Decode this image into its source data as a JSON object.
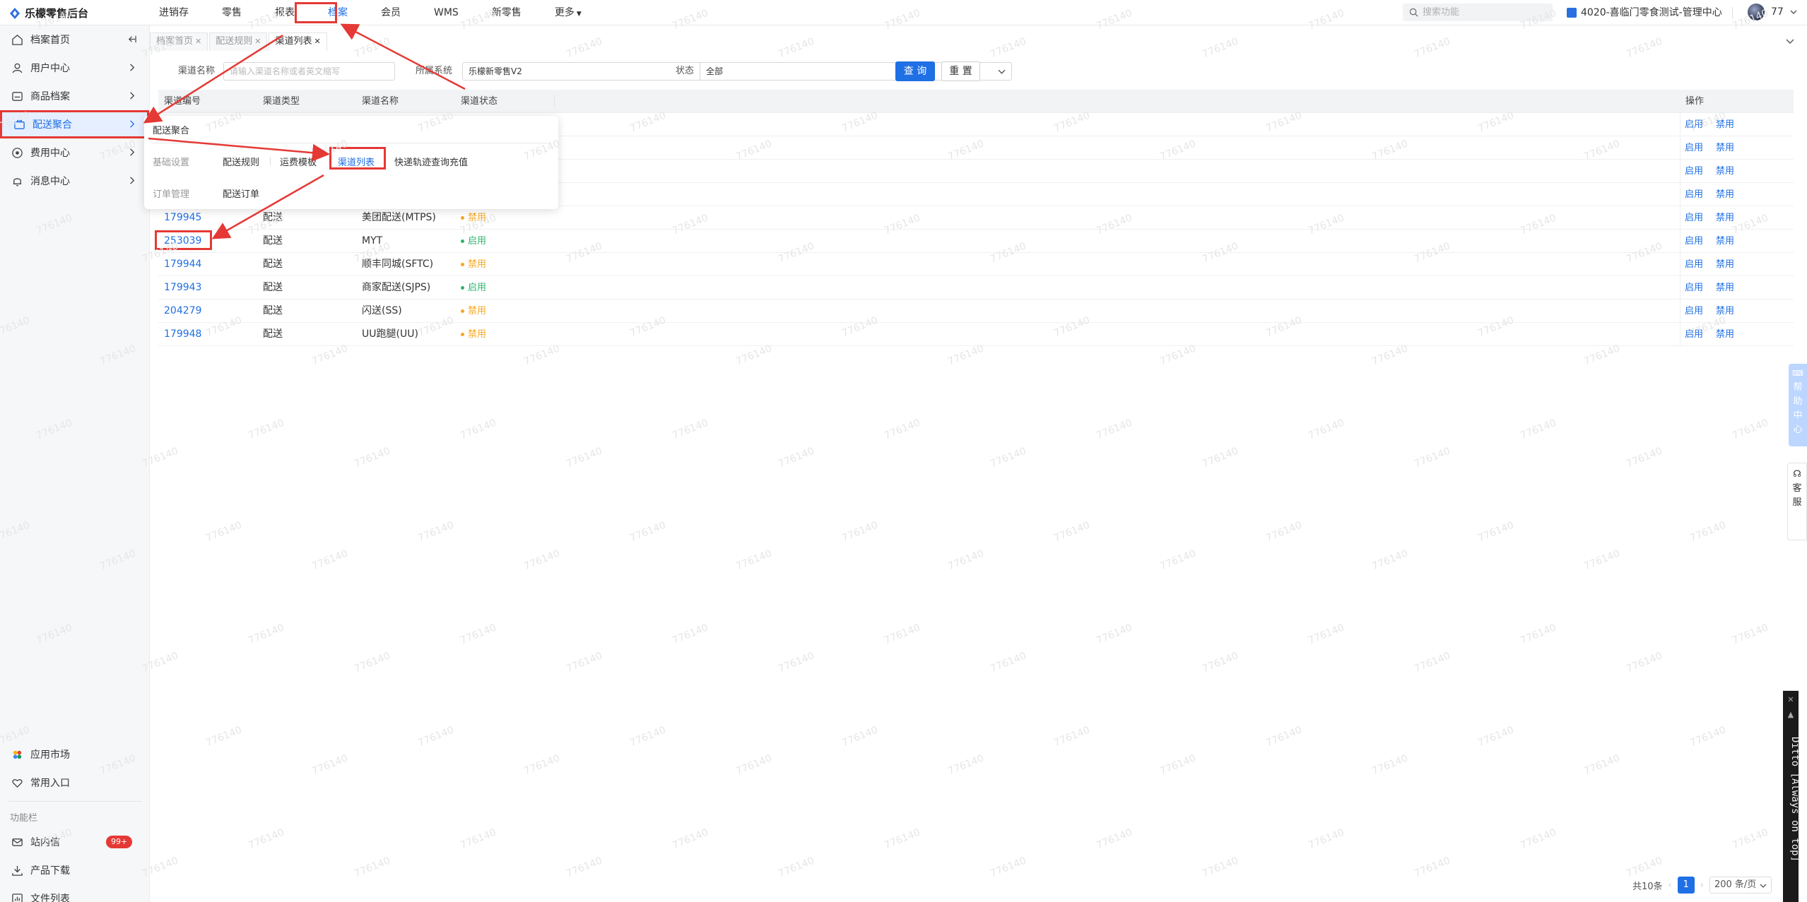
{
  "app": {
    "title": "乐檬零售后台"
  },
  "topnav": [
    {
      "label": "进销存"
    },
    {
      "label": "零售"
    },
    {
      "label": "报表"
    },
    {
      "label": "档案",
      "active": true
    },
    {
      "label": "会员"
    },
    {
      "label": "WMS"
    },
    {
      "label": "新零售"
    },
    {
      "label": "更多"
    }
  ],
  "header": {
    "search_placeholder": "搜索功能",
    "store": "4020-喜临门零食测试-管理中心",
    "user": "77"
  },
  "sidebar": {
    "items": [
      {
        "label": "档案首页",
        "icon": "home-icon"
      },
      {
        "label": "用户中心",
        "icon": "user-icon"
      },
      {
        "label": "商品档案",
        "icon": "goods-icon"
      },
      {
        "label": "配送聚合",
        "icon": "delivery-icon",
        "active": true
      },
      {
        "label": "费用中心",
        "icon": "fee-icon"
      },
      {
        "label": "消息中心",
        "icon": "bell-icon"
      }
    ],
    "bottom": {
      "app_market": "应用市场",
      "common_entry": "常用入口",
      "section_label": "功能栏",
      "inbox": "站内信",
      "inbox_badge": "99+",
      "download": "产品下载",
      "files": "文件列表"
    }
  },
  "tabs": [
    {
      "label": "档案首页"
    },
    {
      "label": "配送规则"
    },
    {
      "label": "渠道列表",
      "active": true
    }
  ],
  "filters": {
    "channel_name_label": "渠道名称",
    "channel_name_placeholder": "请输入渠道名称或者英文缩写",
    "system_label": "所属系统",
    "system_value": "乐檬新零售V2",
    "status_label": "状态",
    "status_value": "全部",
    "query_button": "查 询",
    "reset_button": "重 置"
  },
  "table": {
    "columns": [
      "渠道编号",
      "渠道类型",
      "渠道名称",
      "渠道状态",
      "操作"
    ],
    "rows": [
      {
        "id": "",
        "type": "",
        "name": "",
        "status": "",
        "status_color": ""
      },
      {
        "id": "",
        "type": "",
        "name": "",
        "status": "",
        "status_color": ""
      },
      {
        "id": "",
        "type": "",
        "name": "",
        "status": "",
        "status_color": ""
      },
      {
        "id": "",
        "type": "",
        "name": "",
        "status": "",
        "status_color": ""
      },
      {
        "id": "179945",
        "type": "配送",
        "name": "美团配送(MTPS)",
        "status": "禁用",
        "status_color": "#f5a623"
      },
      {
        "id": "253039",
        "type": "配送",
        "name": "MYT",
        "status": "启用",
        "status_color": "#2fb36d"
      },
      {
        "id": "179944",
        "type": "配送",
        "name": "顺丰同城(SFTC)",
        "status": "禁用",
        "status_color": "#f5a623"
      },
      {
        "id": "179943",
        "type": "配送",
        "name": "商家配送(SJPS)",
        "status": "启用",
        "status_color": "#2fb36d"
      },
      {
        "id": "204279",
        "type": "配送",
        "name": "闪送(SS)",
        "status": "禁用",
        "status_color": "#f5a623"
      },
      {
        "id": "179948",
        "type": "配送",
        "name": "UU跑腿(UU)",
        "status": "禁用",
        "status_color": "#f5a623"
      }
    ],
    "op_enable": "启用",
    "op_disable": "禁用"
  },
  "popover": {
    "title": "配送聚合",
    "section1": "基础设置",
    "items1": [
      "配送规则",
      "运费模板",
      "渠道列表",
      "快递轨迹查询充值"
    ],
    "section2": "订单管理",
    "items2": [
      "配送订单"
    ]
  },
  "side_widgets": {
    "help": [
      "帮",
      "助",
      "中",
      "心"
    ],
    "service": [
      "客",
      "服"
    ]
  },
  "ditto": "Ditto [Always on top]",
  "pagination": {
    "total": "共10条",
    "current": "1",
    "page_size": "200 条/页"
  },
  "watermark": "776140",
  "colors": {
    "accent": "#1f6fe5",
    "highlight": "#e53935",
    "enabled": "#2fb36d",
    "disabled": "#f5a623"
  }
}
